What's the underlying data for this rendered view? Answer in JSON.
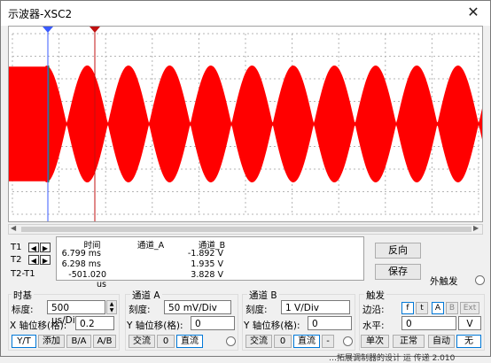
{
  "window": {
    "title": "示波器-XSC2",
    "close_glyph": "✕"
  },
  "screen": {
    "bg": "#ffffff",
    "grid_color": "#b4b4b4",
    "signal_color": "#ff0000",
    "cursor1_color": "#3a5bff",
    "cursor2_color": "#c01010",
    "cursor1_label": "1",
    "cursor2_label": "2",
    "envelope_peaks": 11
  },
  "readout": {
    "headers": [
      "时间",
      "通道_A",
      "通道_B"
    ],
    "rows": [
      {
        "label": "T1",
        "time": "6.799 ms",
        "a": "",
        "b": "-1.892 V"
      },
      {
        "label": "T2",
        "time": "6.298 ms",
        "a": "",
        "b": "1.935 V"
      },
      {
        "label": "T2-T1",
        "time": "-501.020 us",
        "a": "",
        "b": "3.828 V"
      }
    ]
  },
  "buttons": {
    "reverse": "反向",
    "save": "保存",
    "external_trigger": "外触发"
  },
  "timebase": {
    "title": "时基",
    "scale_label": "标度:",
    "scale_value": "500 us/Div",
    "xpos_label": "X 轴位移(格):",
    "xpos_value": "0.2",
    "modes": [
      "Y/T",
      "添加",
      "B/A",
      "A/B"
    ]
  },
  "channel_a": {
    "title": "通道 A",
    "scale_label": "刻度:",
    "scale_value": "50 mV/Div",
    "ypos_label": "Y 轴位移(格):",
    "ypos_value": "0",
    "coupling": [
      "交流",
      "0",
      "直流"
    ]
  },
  "channel_b": {
    "title": "通道 B",
    "scale_label": "刻度:",
    "scale_value": "1  V/Div",
    "ypos_label": "Y 轴位移(格):",
    "ypos_value": "0",
    "coupling": [
      "交流",
      "0",
      "直流",
      "-"
    ]
  },
  "trigger": {
    "title": "触发",
    "edge_label": "边沿:",
    "edge_buttons": [
      "f",
      "t",
      "A",
      "B",
      "Ext"
    ],
    "level_label": "水平:",
    "level_value": "0",
    "level_unit": "V",
    "modes": [
      "单次",
      "正常",
      "自动",
      "无"
    ]
  },
  "background_fragments": {
    "left": [
      "",
      "0",
      "",
      "",
      "X",
      "",
      "5"
    ],
    "right": [
      "R",
      "0"
    ],
    "bottom": "…拓展调制器的设计    运 传递 2.010"
  }
}
